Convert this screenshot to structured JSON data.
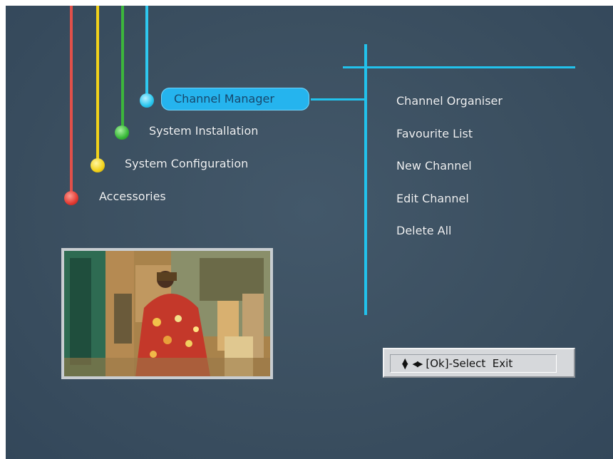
{
  "menu": {
    "items": [
      {
        "label": "Channel Manager",
        "selected": true,
        "color": "#28c6ee"
      },
      {
        "label": "System Installation",
        "color": "#38b838"
      },
      {
        "label": "System Configuration",
        "color": "#f2d21a"
      },
      {
        "label": "Accessories",
        "color": "#e23a32"
      }
    ]
  },
  "submenu": {
    "items": [
      "Channel Organiser",
      "Favourite List",
      "New Channel",
      "Edit Channel",
      "Delete All"
    ]
  },
  "help": {
    "text": "[Ok]-Select  Exit"
  },
  "colors": {
    "background": "#3a4e5e",
    "accent": "#25b4ee",
    "line": "#22c2ec"
  },
  "icons": [
    "up-down-arrow-icon",
    "left-right-arrow-icon"
  ]
}
